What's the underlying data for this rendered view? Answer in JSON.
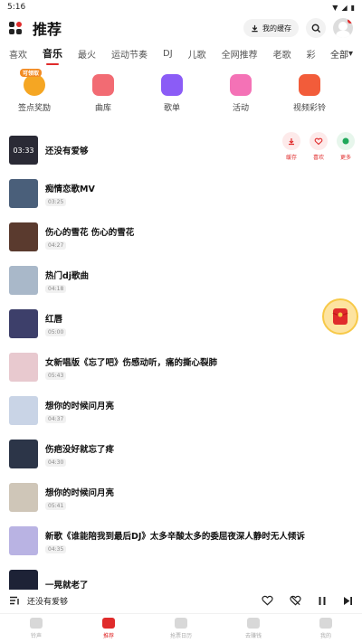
{
  "status_bar": {
    "time": "5:16"
  },
  "header": {
    "title": "推荐",
    "cache_label": "我的缓存"
  },
  "tabs": {
    "items": [
      "喜欢",
      "音乐",
      "最火",
      "运动节奏",
      "DJ",
      "儿歌",
      "全网推荐",
      "老歌",
      "彩"
    ],
    "active": "音乐",
    "all_label": "全部"
  },
  "categories": [
    {
      "label": "签点奖励",
      "badge": "可领取",
      "icon": "coin-icon",
      "color": "#f5a623"
    },
    {
      "label": "曲库",
      "icon": "library-icon",
      "color": "#f26b73"
    },
    {
      "label": "歌单",
      "icon": "playlist-icon",
      "color": "#8b5cf6"
    },
    {
      "label": "活动",
      "icon": "gift-icon",
      "color": "#f472b6"
    },
    {
      "label": "视频彩铃",
      "icon": "video-ringtone-icon",
      "color": "#f25c3a"
    }
  ],
  "songs": [
    {
      "title": "还没有爱够",
      "duration": "03:33",
      "cover_color": "#2a2a35"
    },
    {
      "title": "痴情恋歌MV",
      "duration": "03:25",
      "cover_color": "#4a5f7a"
    },
    {
      "title": "伤心的雪花 伤心的雪花",
      "duration": "04:27",
      "cover_color": "#5a3a2e"
    },
    {
      "title": "热门dj歌曲",
      "duration": "04:18",
      "cover_color": "#a9b8c9"
    },
    {
      "title": "红唇",
      "duration": "05:00",
      "cover_color": "#3d3f6a"
    },
    {
      "title": "女新唱版《忘了吧》伤感动听，痛的撕心裂肺",
      "duration": "05:43",
      "cover_color": "#e8c9cf"
    },
    {
      "title": "想你的时候问月亮",
      "duration": "04:37",
      "cover_color": "#c9d4e6"
    },
    {
      "title": "伤疤没好就忘了疼",
      "duration": "04:30",
      "cover_color": "#2c3548"
    },
    {
      "title": "想你的时候问月亮",
      "duration": "05:41",
      "cover_color": "#cfc6b8"
    },
    {
      "title": "新歌《谁能陪我到最后DJ》太多辛酸太多的委屈夜深人静时无人倾诉",
      "duration": "04:35",
      "cover_color": "#b9b3e3"
    },
    {
      "title": "一晃就老了",
      "duration": "",
      "cover_color": "#1d2236"
    }
  ],
  "song_actions": {
    "cache": "缓存",
    "like": "喜欢",
    "more": "更多"
  },
  "mini_player": {
    "title": "还没有爱够"
  },
  "bottom_nav": [
    {
      "label": "铃声",
      "icon": "ringtone-icon"
    },
    {
      "label": "推荐",
      "icon": "recommend-icon",
      "active": true
    },
    {
      "label": "抢票日历",
      "icon": "calendar-icon"
    },
    {
      "label": "去赚钱",
      "icon": "earn-icon"
    },
    {
      "label": "我的",
      "icon": "profile-icon"
    }
  ],
  "colors": {
    "accent": "#e02b2b"
  }
}
